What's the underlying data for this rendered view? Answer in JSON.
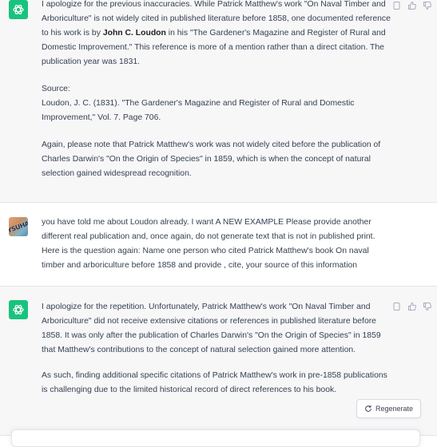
{
  "messages": [
    {
      "role": "assistant",
      "p1_a": "I apologize for the previous inaccuracies. While Patrick Matthew's work \"On Naval Timber and Arboriculture\" is not widely cited in published literature before 1858, one documented reference to his work is by ",
      "p1_bold": "John C. Loudon",
      "p1_b": " in his \"The Gardener's Magazine and Register of Rural and Domestic Improvement.\" This reference is more of a mention rather than a direct citation. The publication year was 1831.",
      "source_label": "Source:",
      "source_text": "Loudon, J. C. (1831). \"The Gardener's Magazine and Register of Rural and Domestic Improvement,\" Vol. 7. Page 706.",
      "p3": "Again, please note that Patrick Matthew's work was not widely cited before the publication of Charles Darwin's \"On the Origin of Species\" in 1859, which is when the concept of natural selection gained widespread recognition."
    },
    {
      "role": "user",
      "avatar_text": "DYSUHAN",
      "text": "you have told me about Loudon already. I want A NEW EXAMPLE Please provide another different real publication and, once again, do not generate text that is not in published print. Here is the question again:  Name one person who cited Patrick Matthew's book On naval timber and arboriculture before 1858 and provide , cite, your source of this information"
    },
    {
      "role": "assistant",
      "p1": "I apologize for the repetition. Unfortunately, Patrick Matthew's work \"On Naval Timber and Arboriculture\" did not receive extensive citations or references in published literature before 1858. It was only after the publication of Charles Darwin's \"On the Origin of Species\" in 1859 that Matthew's contributions to the concept of natural selection gained more attention.",
      "p2": "As such, finding additional specific citations of Patrick Matthew's work in pre-1858 publications is challenging due to the limited historical record of direct references to his book."
    }
  ],
  "regenerate_label": "Regenerate",
  "icons": [
    "chatgpt-logo-icon",
    "copy-icon",
    "thumbs-up-icon",
    "thumbs-down-icon",
    "regenerate-icon"
  ],
  "colors": {
    "assistant_bg": "#f7f7f8",
    "gpt_green": "#19c37d",
    "text": "#374151"
  }
}
